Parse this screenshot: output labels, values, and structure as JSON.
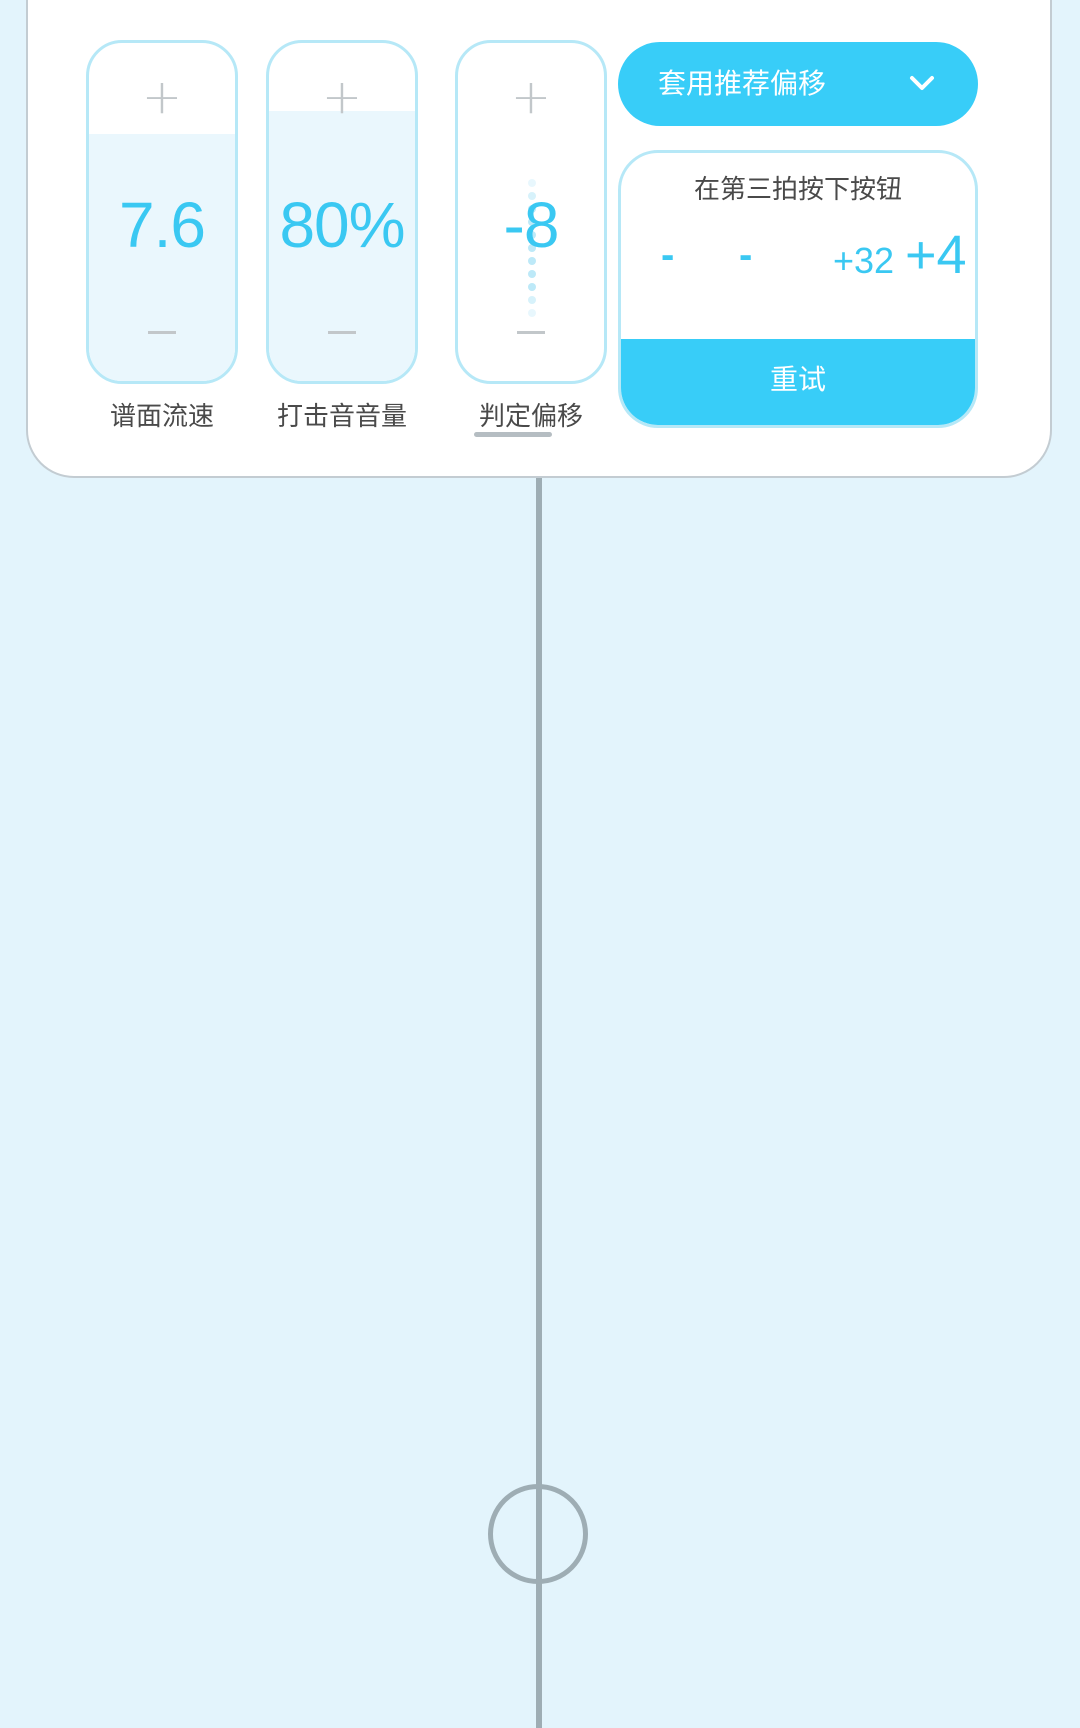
{
  "sliders": [
    {
      "label": "谱面流速",
      "value": "7.6",
      "plus": "+",
      "fill_fraction": 0.73
    },
    {
      "label": "打击音音量",
      "value": "80%",
      "plus": "+",
      "fill_fraction": 0.8
    },
    {
      "label": "判定偏移",
      "value": "-8",
      "plus": "+",
      "fill_fraction": 0
    }
  ],
  "recommend": {
    "label": "套用推荐偏移"
  },
  "calibration": {
    "instruction": "在第三拍按下按钮",
    "results": [
      "-",
      "-",
      "+32",
      "+4"
    ],
    "retry_label": "重试"
  },
  "colors": {
    "accent": "#38cdf8",
    "accent_text": "#3ac8f2",
    "background": "#e3f4fc",
    "track": "#9eadb4"
  },
  "icons": {
    "more": "more-horizontal-icon",
    "chevron": "chevron-down-icon",
    "track_target": "circle-target-icon"
  }
}
